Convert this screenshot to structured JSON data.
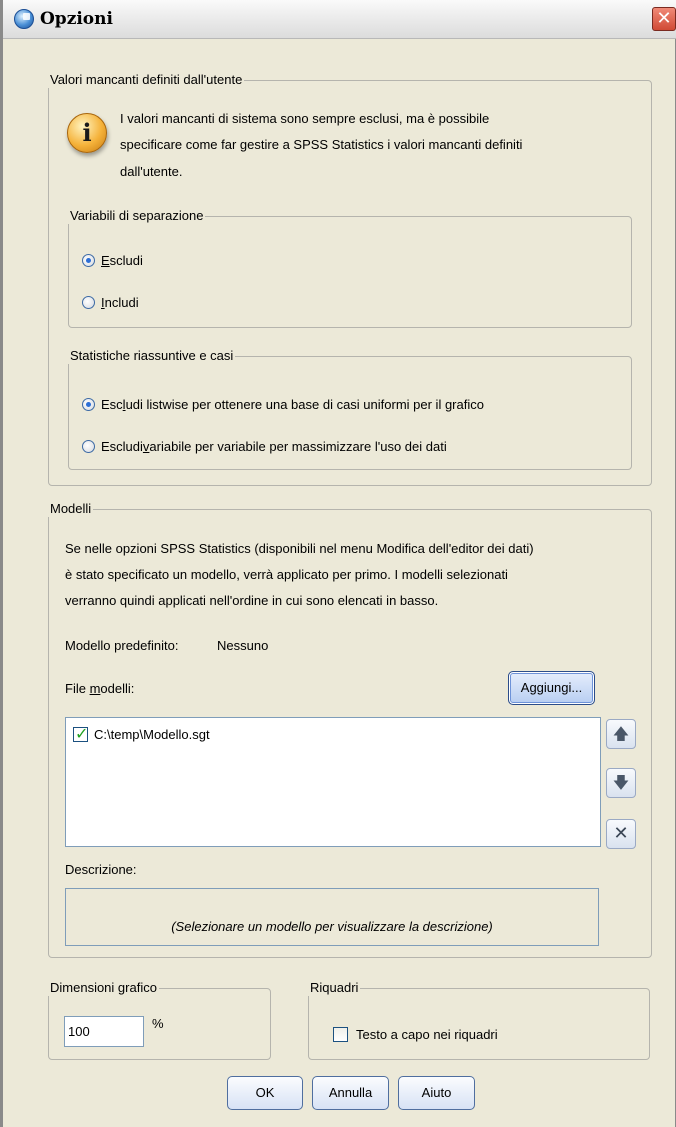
{
  "window": {
    "title": "Opzioni",
    "close_glyph": "✕",
    "icon": "spss-app-icon"
  },
  "missing": {
    "legend": "Valori mancanti definiti dall'utente",
    "icon": "info-icon",
    "info_lines": [
      "I valori mancanti di sistema sono sempre esclusi, ma è possibile",
      "specificare come far gestire a SPSS Statistics i valori mancanti definiti",
      "dall'utente."
    ],
    "split": {
      "legend": "Variabili di separazione",
      "options": [
        {
          "mnemonic": "E",
          "rest": "scludi",
          "checked": true
        },
        {
          "mnemonic": "I",
          "rest": "ncludi",
          "checked": false
        }
      ]
    },
    "summary": {
      "legend": "Statistiche riassuntive e casi",
      "opt1": {
        "pre": "Esc",
        "mnemonic": "l",
        "post": "udi listwise per ottenere una base di casi uniformi per il grafico",
        "checked": true
      },
      "opt2": {
        "pre": "Escludi ",
        "mnemonic": "v",
        "post": "ariabile per variabile per massimizzare l'uso dei dati",
        "checked": false
      }
    }
  },
  "templates": {
    "legend": "Modelli",
    "description_lines": [
      "Se nelle opzioni SPSS Statistics (disponibili nel menu Modifica dell'editor dei dati)",
      "è stato specificato un modello, verrà applicato per primo. I modelli selezionati",
      "verranno quindi applicati nell'ordine in cui sono elencati in basso."
    ],
    "default_label": "Modello predefinito:",
    "default_value": "Nessuno",
    "files_label_pre": "File ",
    "files_label_mnemonic": "m",
    "files_label_post": "odelli:",
    "add_button": "Aggiungi...",
    "files": [
      {
        "path": "C:\\temp\\Modello.sgt",
        "checked": true
      }
    ],
    "move_up_icon": "arrow-up-icon",
    "move_down_icon": "arrow-down-icon",
    "remove_icon": "delete-x-icon",
    "desc_label": "Descrizione:",
    "desc_placeholder": "(Selezionare un modello per visualizzare la descrizione)"
  },
  "chart_size": {
    "legend": "Dimensioni grafico",
    "value": "100",
    "unit": "%"
  },
  "panels": {
    "legend": "Riquadri",
    "wrap_label": "Testo a capo nei riquadri",
    "wrap_checked": false
  },
  "buttons": {
    "ok": "OK",
    "cancel": "Annulla",
    "help": "Aiuto"
  }
}
